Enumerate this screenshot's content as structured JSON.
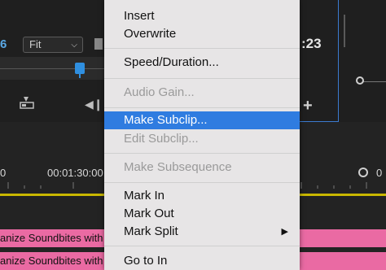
{
  "source_monitor": {
    "timecode_fragment": "6",
    "zoom_select": {
      "value": "Fit"
    }
  },
  "program_monitor": {
    "timecode_fragment": ":23"
  },
  "timeline": {
    "ruler_left_zero": "0",
    "ruler_time": "00:01:30:00",
    "ruler_right_fragment": "0",
    "clips": [
      {
        "label": "anize Soundbites with"
      },
      {
        "label": "anize Soundbites with"
      }
    ]
  },
  "context_menu": {
    "items": [
      {
        "label": "Insert",
        "enabled": true
      },
      {
        "label": "Overwrite",
        "enabled": true
      },
      {
        "label": "Speed/Duration...",
        "enabled": true
      },
      {
        "label": "Audio Gain...",
        "enabled": false
      },
      {
        "label": "Make Subclip...",
        "enabled": true,
        "selected": true
      },
      {
        "label": "Edit Subclip...",
        "enabled": false
      },
      {
        "label": "Make Subsequence",
        "enabled": false
      },
      {
        "label": "Mark In",
        "enabled": true
      },
      {
        "label": "Mark Out",
        "enabled": true
      },
      {
        "label": "Mark Split",
        "enabled": true,
        "has_submenu": true
      },
      {
        "label": "Go to In",
        "enabled": true
      }
    ]
  },
  "colors": {
    "accent_blue": "#2f7ce0",
    "clip_pink": "#ea6aa3",
    "timeline_yellow": "#c9b800"
  }
}
